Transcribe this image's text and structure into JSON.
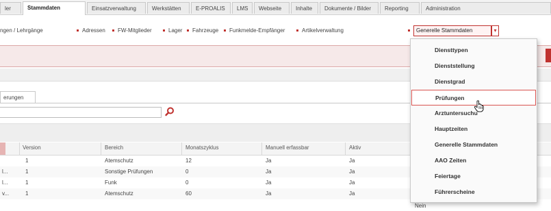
{
  "top_tabs": [
    "ler",
    "Stammdaten",
    "Einsatzverwaltung",
    "Werkstätten",
    "E-PROALIS",
    "LMS",
    "Webseite",
    "Inhalte",
    "Dokumente / Bilder",
    "Reporting",
    "Administration"
  ],
  "active_tab": "Stammdaten",
  "sub_nav": [
    "ngen / Lehrgänge",
    "Adressen",
    "FW-Mitglieder",
    "Lager",
    "Fahrzeuge",
    "Funkmelde-Empfänger",
    "Artikelverwaltung"
  ],
  "sub_nav_active": "Generelle Stammdaten",
  "sub_nav_arrow": "▾",
  "inner_tab": "erungen",
  "search": {
    "placeholder": "",
    "value": ""
  },
  "table": {
    "columns": [
      "Version",
      "Bereich",
      "Monatszyklus",
      "Manuell erfassbar",
      "Aktiv"
    ],
    "rows": [
      {
        "prefix": "",
        "version": "1",
        "bereich": "Atemschutz",
        "monatszyklus": "12",
        "manuell": "Ja",
        "aktiv": "Ja"
      },
      {
        "prefix": "l...",
        "version": "1",
        "bereich": "Sonstige Prüfungen",
        "monatszyklus": "0",
        "manuell": "Ja",
        "aktiv": "Ja"
      },
      {
        "prefix": "l...",
        "version": "1",
        "bereich": "Funk",
        "monatszyklus": "0",
        "manuell": "Ja",
        "aktiv": "Ja"
      },
      {
        "prefix": "v...",
        "version": "1",
        "bereich": "Atemschutz",
        "monatszyklus": "60",
        "manuell": "Ja",
        "aktiv": "Ja"
      }
    ],
    "last_extra": "Nein"
  },
  "dropdown": {
    "items": [
      "Diensttypen",
      "Dienststellung",
      "Dienstgrad",
      "Prüfungen",
      "Arztuntersuchu",
      "Hauptzeiten",
      "Generelle Stammdaten",
      "AAO Zeiten",
      "Feiertage",
      "Führerscheine"
    ],
    "highlighted": "Prüfungen"
  },
  "colors": {
    "accent": "#c0322f",
    "highlight_border": "#d9534f"
  }
}
